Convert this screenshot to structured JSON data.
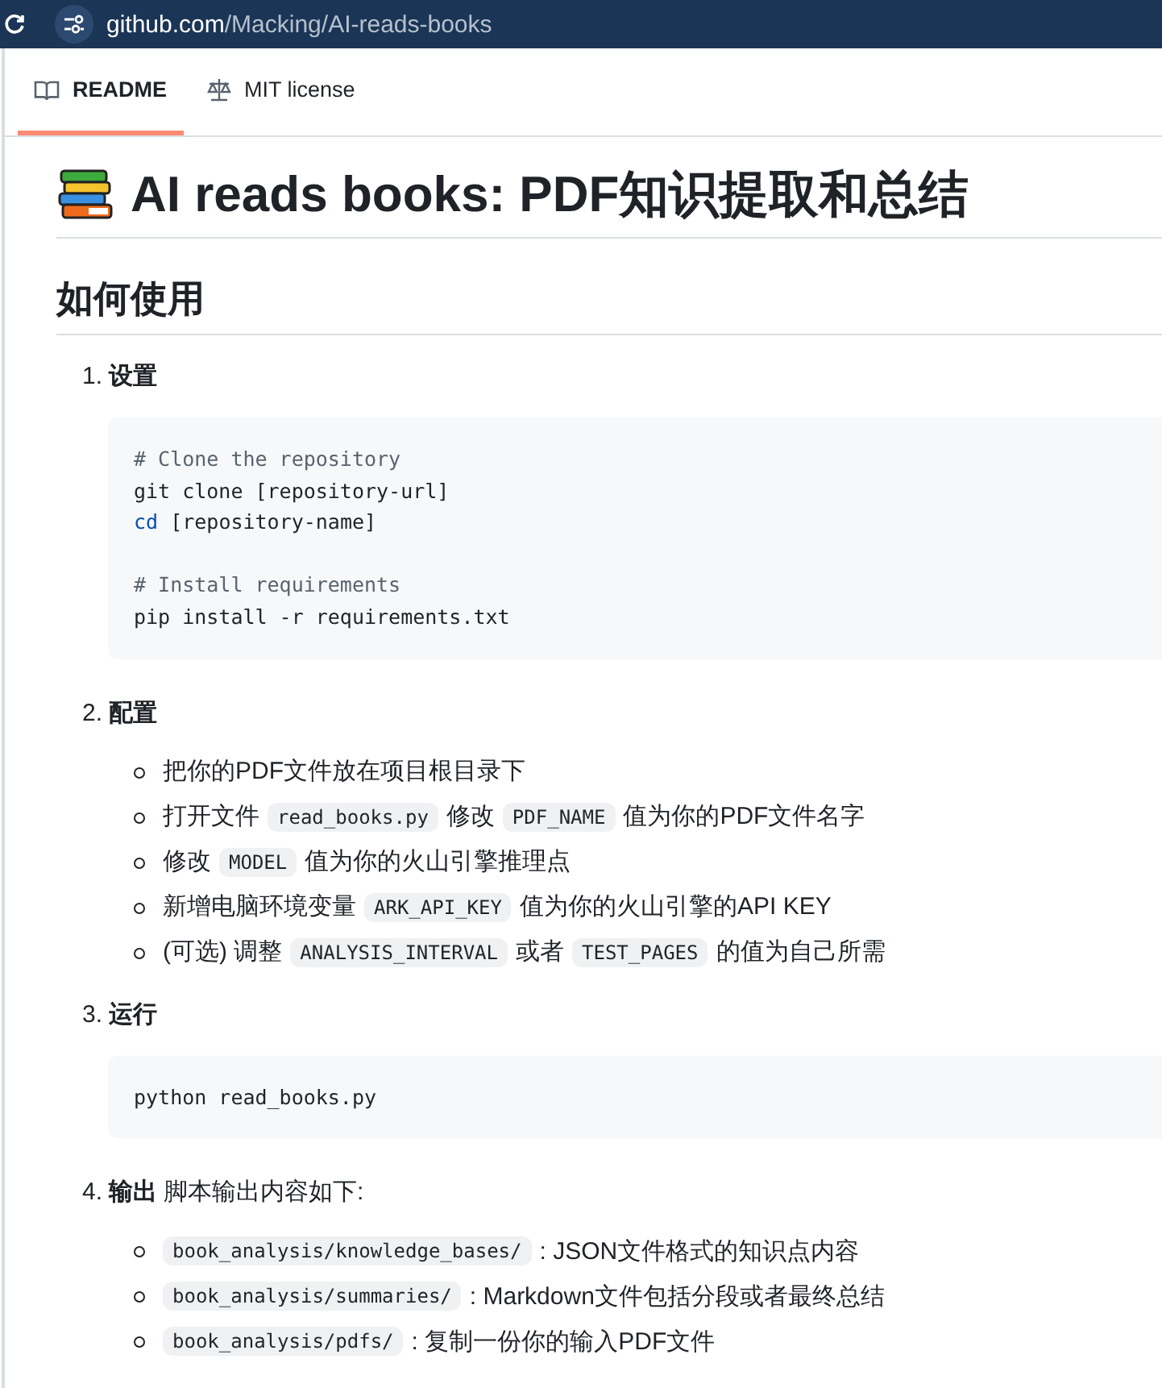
{
  "address_bar": {
    "host": "github.com",
    "path": "/Macking/AI-reads-books"
  },
  "tabs": [
    {
      "label": "README",
      "selected": true
    },
    {
      "label": "MIT license",
      "selected": false
    }
  ],
  "title": "AI reads books: PDF知识提取和总结",
  "section_heading": "如何使用",
  "steps": [
    {
      "number": "1.",
      "title": "设置",
      "kind": "code",
      "code": [
        {
          "kind": "comment",
          "segments": [
            {
              "kind": "plain",
              "text": "# Clone the repository"
            }
          ]
        },
        {
          "kind": "code",
          "segments": [
            {
              "kind": "plain",
              "text": "git clone [repository-url]"
            }
          ]
        },
        {
          "kind": "code",
          "segments": [
            {
              "kind": "builtin",
              "text": "cd"
            },
            {
              "kind": "plain",
              "text": " [repository-name]"
            }
          ]
        },
        {
          "kind": "blank"
        },
        {
          "kind": "comment",
          "segments": [
            {
              "kind": "plain",
              "text": "# Install requirements"
            }
          ]
        },
        {
          "kind": "code",
          "segments": [
            {
              "kind": "plain",
              "text": "pip install -r requirements.txt"
            }
          ]
        }
      ]
    },
    {
      "number": "2.",
      "title": "配置",
      "kind": "list",
      "items": [
        [
          {
            "kind": "text",
            "text": "把你的PDF文件放在项目根目录下"
          }
        ],
        [
          {
            "kind": "text",
            "text": "打开文件"
          },
          {
            "kind": "code",
            "text": "read_books.py"
          },
          {
            "kind": "text",
            "text": "修改"
          },
          {
            "kind": "code",
            "text": "PDF_NAME"
          },
          {
            "kind": "text",
            "text": "值为你的PDF文件名字"
          }
        ],
        [
          {
            "kind": "text",
            "text": "修改"
          },
          {
            "kind": "code",
            "text": "MODEL"
          },
          {
            "kind": "text",
            "text": "值为你的火山引擎推理点"
          }
        ],
        [
          {
            "kind": "text",
            "text": "新增电脑环境变量"
          },
          {
            "kind": "code",
            "text": "ARK_API_KEY"
          },
          {
            "kind": "text",
            "text": "值为你的火山引擎的API KEY"
          }
        ],
        [
          {
            "kind": "text",
            "text": "(可选) 调整"
          },
          {
            "kind": "code",
            "text": "ANALYSIS_INTERVAL"
          },
          {
            "kind": "text",
            "text": "或者"
          },
          {
            "kind": "code",
            "text": "TEST_PAGES"
          },
          {
            "kind": "text",
            "text": "的值为自己所需"
          }
        ]
      ]
    },
    {
      "number": "3.",
      "title": "运行",
      "kind": "code",
      "code": [
        {
          "kind": "code",
          "segments": [
            {
              "kind": "plain",
              "text": "python read_books.py"
            }
          ]
        }
      ]
    },
    {
      "number": "4.",
      "title": "输出",
      "after": "脚本输出内容如下:",
      "kind": "list",
      "items": [
        [
          {
            "kind": "code",
            "text": "book_analysis/knowledge_bases/"
          },
          {
            "kind": "text",
            "text": ": JSON文件格式的知识点内容"
          }
        ],
        [
          {
            "kind": "code",
            "text": "book_analysis/summaries/"
          },
          {
            "kind": "text",
            "text": ": Markdown文件包括分段或者最终总结"
          }
        ],
        [
          {
            "kind": "code",
            "text": "book_analysis/pdfs/"
          },
          {
            "kind": "text",
            "text": ": 复制一份你的输入PDF文件"
          }
        ]
      ]
    }
  ]
}
